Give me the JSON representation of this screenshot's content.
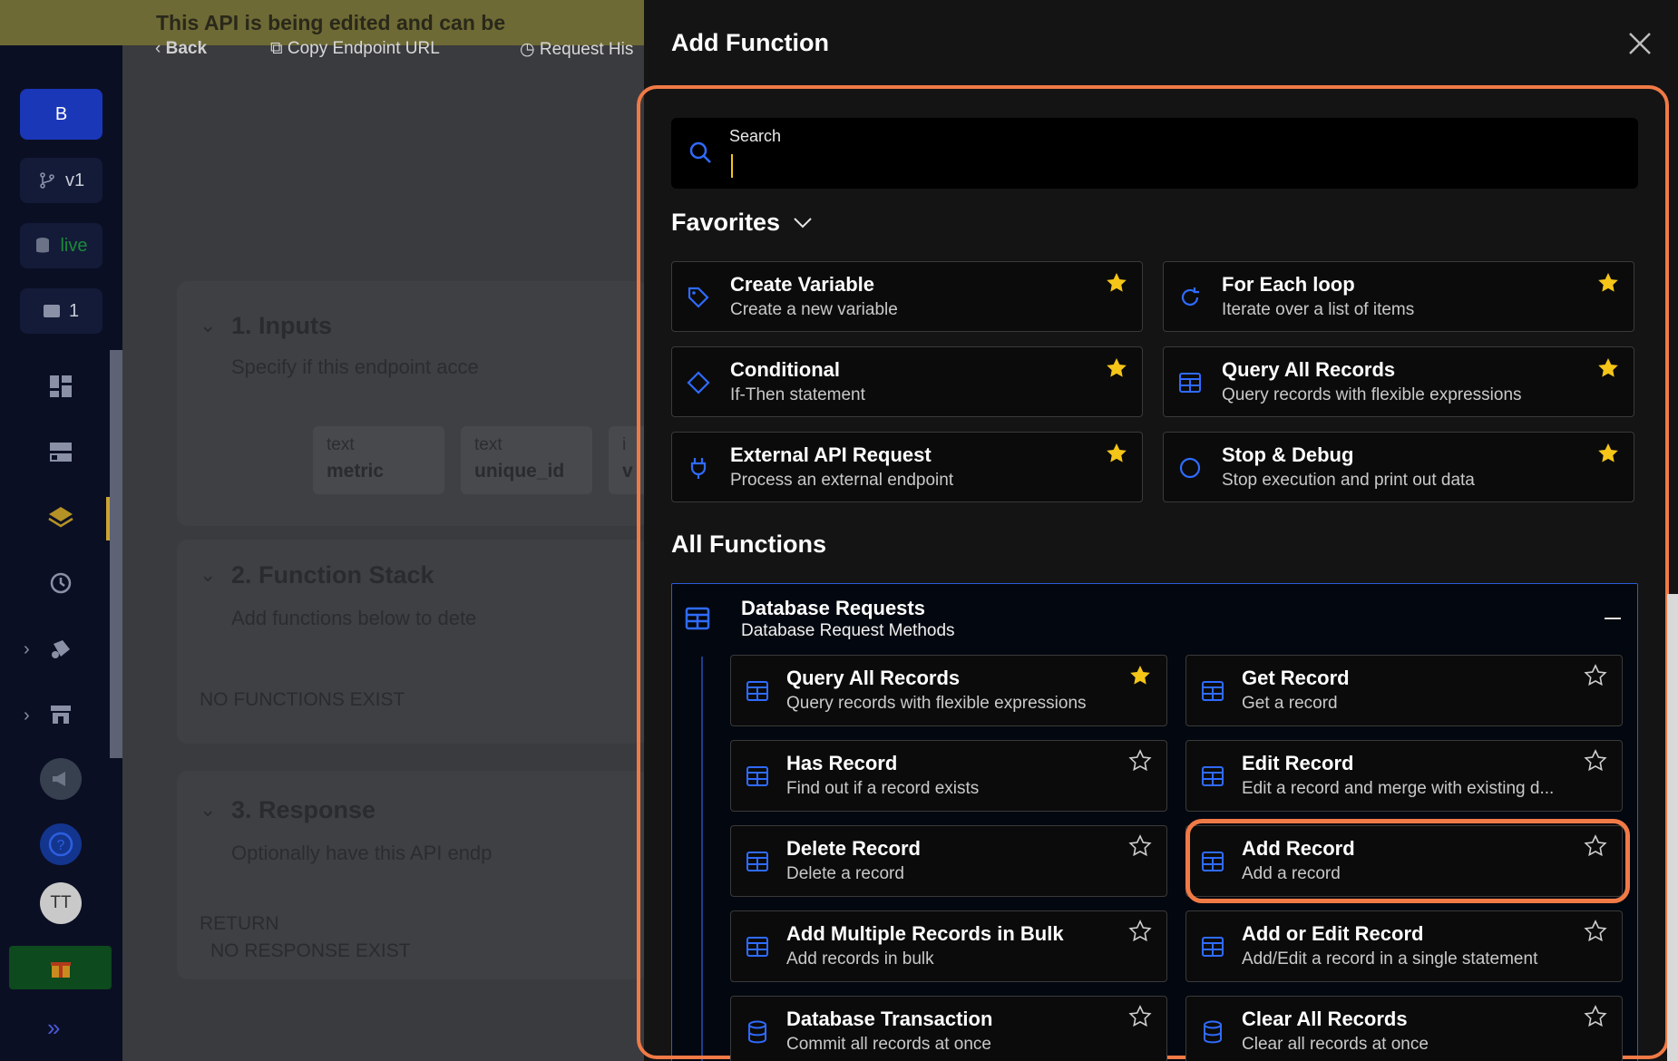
{
  "banner": {
    "text": "This API is being edited and can be"
  },
  "toolbar": {
    "back": "Back",
    "copy": "Copy Endpoint URL",
    "history": "Request His"
  },
  "sidebar": {
    "workspace_initial": "B",
    "branch": "v1",
    "env": "live",
    "comments_count": "1",
    "avatar_initials": "TT"
  },
  "main": {
    "inputs": {
      "title": "1. Inputs",
      "desc": "Specify if this endpoint acce"
    },
    "fields": [
      {
        "type": "text",
        "name": "metric"
      },
      {
        "type": "text",
        "name": "unique_id"
      },
      {
        "type": "i",
        "name": "v"
      }
    ],
    "stack": {
      "title": "2. Function Stack",
      "desc": "Add functions below to dete",
      "empty": "NO FUNCTIONS EXIST"
    },
    "response": {
      "title": "3. Response",
      "desc": "Optionally have this API endp",
      "return_label": "RETURN",
      "empty": "NO RESPONSE EXIST"
    }
  },
  "modal": {
    "title": "Add Function",
    "search": {
      "label": "Search",
      "value": ""
    },
    "favorites_label": "Favorites",
    "all_functions_label": "All Functions",
    "favorites": [
      {
        "title": "Create Variable",
        "desc": "Create a new variable",
        "icon": "tag-icon",
        "starred": true
      },
      {
        "title": "For Each loop",
        "desc": "Iterate over a list of items",
        "icon": "loop-icon",
        "starred": true
      },
      {
        "title": "Conditional",
        "desc": "If-Then statement",
        "icon": "diamond-icon",
        "starred": true
      },
      {
        "title": "Query All Records",
        "desc": "Query records with flexible expressions",
        "icon": "table-icon",
        "starred": true
      },
      {
        "title": "External API Request",
        "desc": "Process an external endpoint",
        "icon": "plug-icon",
        "starred": true
      },
      {
        "title": "Stop & Debug",
        "desc": "Stop execution and print out data",
        "icon": "circle-icon",
        "starred": true
      }
    ],
    "group": {
      "title": "Database Requests",
      "desc": "Database Request Methods",
      "items": [
        {
          "title": "Query All Records",
          "desc": "Query records with flexible expressions",
          "icon": "table-icon",
          "starred": true
        },
        {
          "title": "Get Record",
          "desc": "Get a record",
          "icon": "table-icon",
          "starred": false
        },
        {
          "title": "Has Record",
          "desc": "Find out if a record exists",
          "icon": "table-icon",
          "starred": false
        },
        {
          "title": "Edit Record",
          "desc": "Edit a record and merge with existing d...",
          "icon": "table-icon",
          "starred": false
        },
        {
          "title": "Delete Record",
          "desc": "Delete a record",
          "icon": "table-icon",
          "starred": false
        },
        {
          "title": "Add Record",
          "desc": "Add a record",
          "icon": "table-icon",
          "starred": false
        },
        {
          "title": "Add Multiple Records in Bulk",
          "desc": "Add records in bulk",
          "icon": "table-icon",
          "starred": false
        },
        {
          "title": "Add or Edit Record",
          "desc": "Add/Edit a record in a single statement",
          "icon": "table-icon",
          "starred": false
        },
        {
          "title": "Database Transaction",
          "desc": "Commit all records at once",
          "icon": "database-icon",
          "starred": false
        },
        {
          "title": "Clear All Records",
          "desc": "Clear all records at once",
          "icon": "database-icon",
          "starred": false
        }
      ]
    }
  },
  "colors": {
    "accent": "#f07a46",
    "star": "#f5c518",
    "icon_blue": "#2f6bff"
  }
}
